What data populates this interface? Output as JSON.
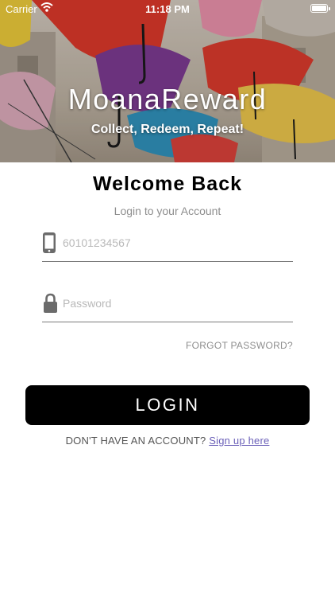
{
  "status_bar": {
    "carrier": "Carrier",
    "time": "11:18 PM"
  },
  "hero": {
    "app_name": "MoanaReward",
    "tagline": "Collect, Redeem, Repeat!"
  },
  "login": {
    "heading": "Welcome Back",
    "subheading": "Login to your Account",
    "phone_placeholder": "60101234567",
    "password_placeholder": "Password",
    "forgot_password": "FORGOT PASSWORD?",
    "login_button": "LOGIN",
    "no_account_text": "DON'T HAVE AN ACCOUNT?",
    "signup_link": "Sign up here"
  },
  "icons": {
    "phone": "mobile-phone-icon",
    "password": "lock-icon",
    "wifi": "wifi-icon",
    "battery": "battery-icon"
  },
  "colors": {
    "login_button_bg": "#000000",
    "link": "#6a5fb8",
    "muted_text": "#8e8e8e"
  }
}
